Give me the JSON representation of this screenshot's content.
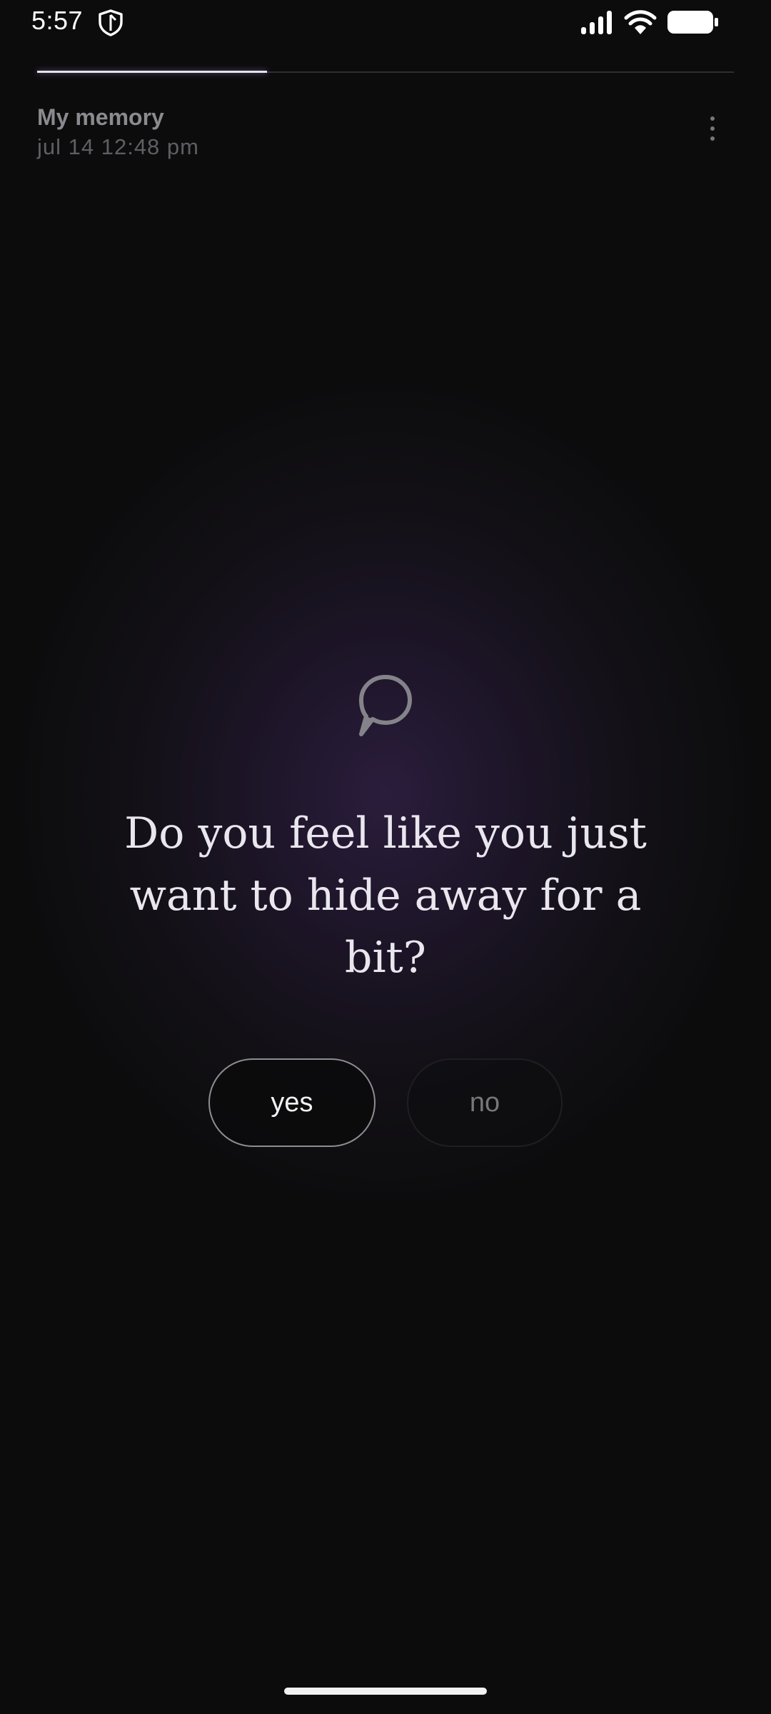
{
  "status_bar": {
    "time": "5:57",
    "icons": [
      "shield-icon",
      "signal-icon",
      "wifi-icon",
      "battery-icon"
    ]
  },
  "progress": {
    "fraction": 0.33
  },
  "header": {
    "title": "My memory",
    "date": "jul 14 12:48 pm",
    "menu_icon": "more-vertical-icon"
  },
  "prompt": {
    "icon": "speech-bubble-icon",
    "question": "Do you feel like you just want to hide away for a bit?"
  },
  "answers": {
    "yes_label": "yes",
    "no_label": "no"
  },
  "colors": {
    "background": "#0c0c0d",
    "glow": "#2a1d3c",
    "text": "#e9e6ee",
    "muted": "#8b8a8f"
  }
}
